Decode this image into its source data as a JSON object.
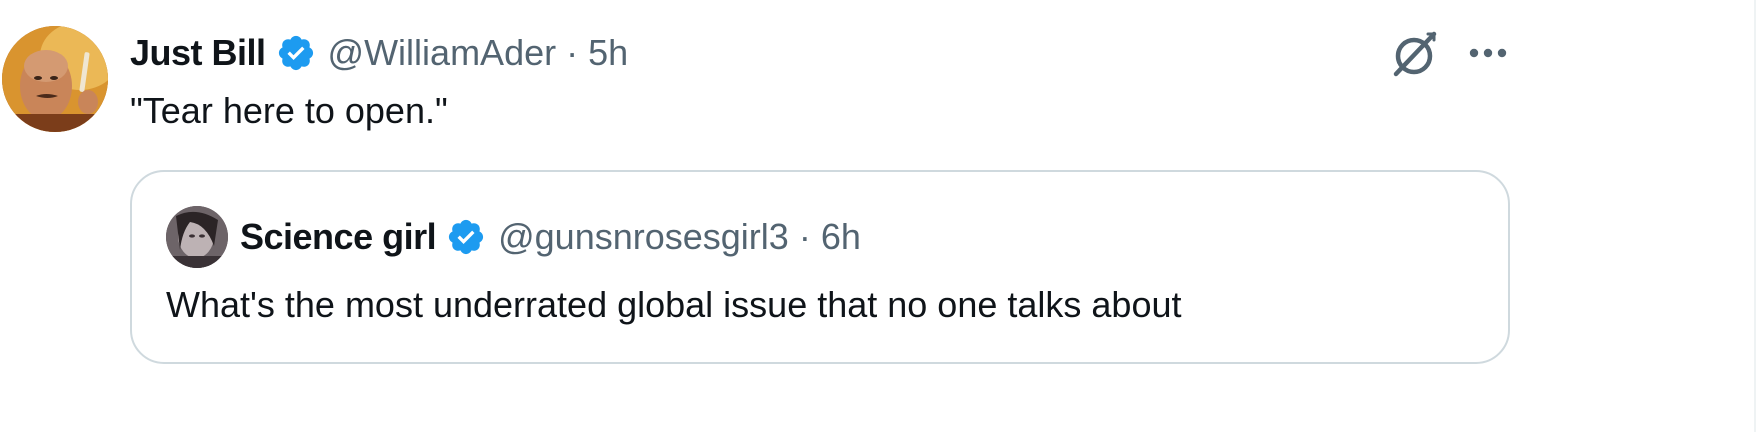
{
  "tweet": {
    "author": {
      "display_name": "Just Bill",
      "handle": "@WilliamAder",
      "verified": true
    },
    "separator": "·",
    "time": "5h",
    "text": "\"Tear here to open.\"",
    "icons": {
      "grok": "grok-icon",
      "more": "more-icon"
    },
    "quoted": {
      "author": {
        "display_name": "Science girl",
        "handle": "@gunsnrosesgirl3",
        "verified": true
      },
      "separator": "·",
      "time": "6h",
      "text": "What's the most underrated global issue that no one talks about"
    }
  },
  "colors": {
    "verified_badge": "#1d9bf0",
    "secondary_text": "#536471",
    "primary_text": "#0f1419",
    "border": "#cfd9de"
  }
}
